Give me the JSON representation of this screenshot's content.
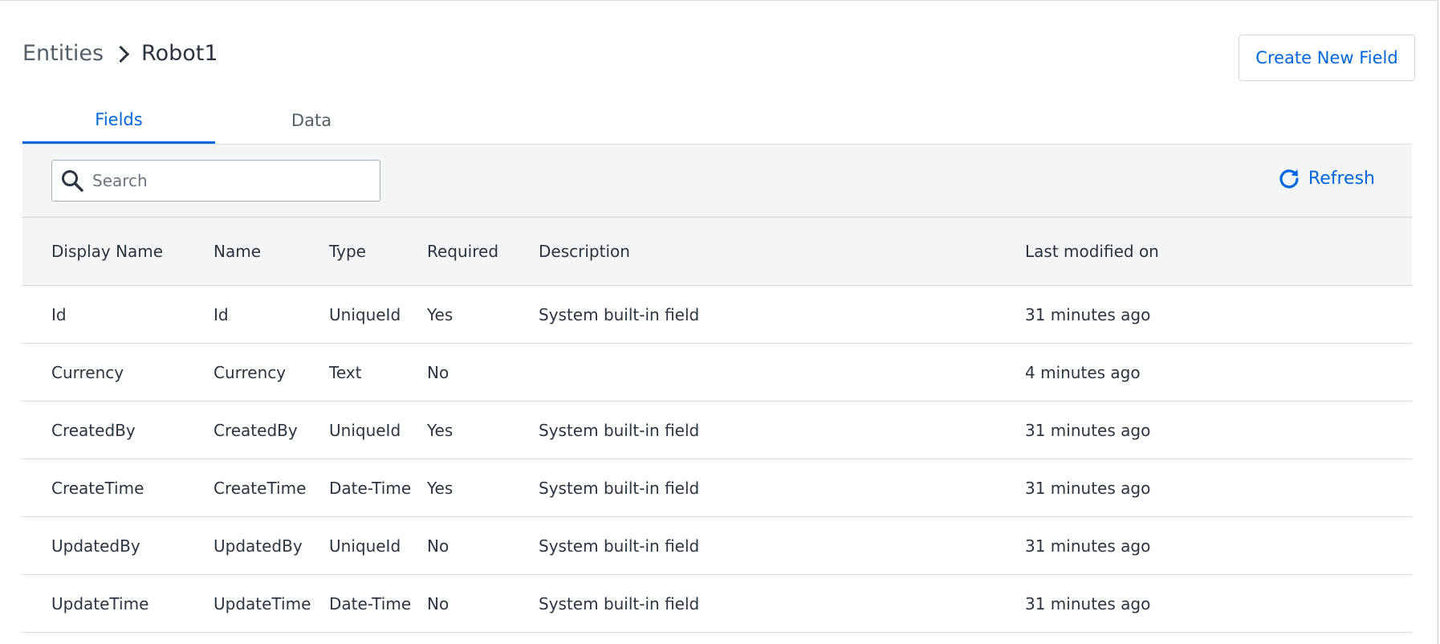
{
  "breadcrumb": {
    "root": "Entities",
    "current": "Robot1"
  },
  "header": {
    "create_label": "Create New Field"
  },
  "tabs": [
    {
      "label": "Fields",
      "active": true
    },
    {
      "label": "Data",
      "active": false
    }
  ],
  "toolbar": {
    "search_placeholder": "Search",
    "search_value": "",
    "refresh_label": "Refresh"
  },
  "table": {
    "columns": [
      "Display Name",
      "Name",
      "Type",
      "Required",
      "Description",
      "Last modified on"
    ],
    "rows": [
      [
        "Id",
        "Id",
        "UniqueId",
        "Yes",
        "System built-in field",
        "31 minutes ago"
      ],
      [
        "Currency",
        "Currency",
        "Text",
        "No",
        "",
        "4 minutes ago"
      ],
      [
        "CreatedBy",
        "CreatedBy",
        "UniqueId",
        "Yes",
        "System built-in field",
        "31 minutes ago"
      ],
      [
        "CreateTime",
        "CreateTime",
        "Date-Time",
        "Yes",
        "System built-in field",
        "31 minutes ago"
      ],
      [
        "UpdatedBy",
        "UpdatedBy",
        "UniqueId",
        "No",
        "System built-in field",
        "31 minutes ago"
      ],
      [
        "UpdateTime",
        "UpdateTime",
        "Date-Time",
        "No",
        "System built-in field",
        "31 minutes ago"
      ]
    ]
  },
  "colors": {
    "accent": "#0067df",
    "text": "#2b3440",
    "muted": "#526069",
    "toolbar_bg": "#f4f5f7"
  },
  "icons": {
    "search": "search-icon",
    "refresh": "refresh-icon",
    "breadcrumb_separator": "chevron-right-icon"
  }
}
